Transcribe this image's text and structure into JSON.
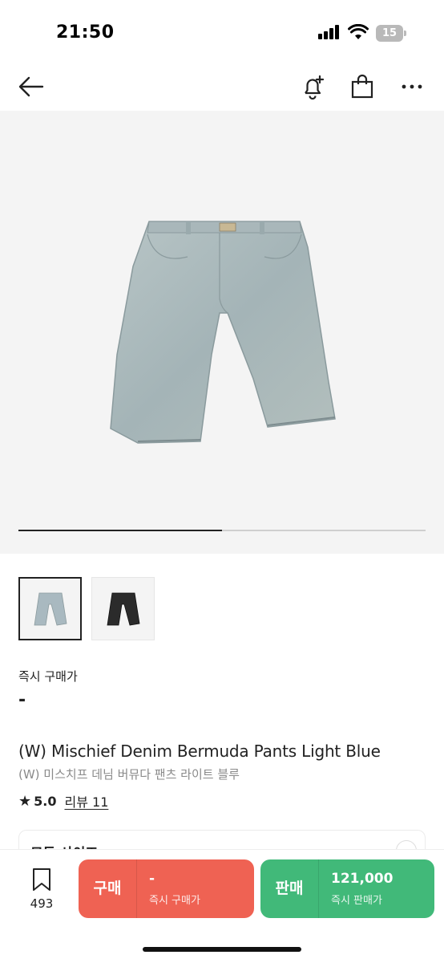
{
  "status_bar": {
    "time": "21:50",
    "battery_level": "15",
    "icons": [
      "cellular-signal-icon",
      "wifi-icon",
      "battery-icon"
    ]
  },
  "top_nav": {
    "icons": [
      "back-arrow-icon",
      "bell-plus-icon",
      "shopping-bag-icon",
      "more-icon"
    ]
  },
  "gallery": {
    "progress_fraction": 0.5,
    "thumbnails": [
      {
        "name": "light-blue-shorts",
        "color": "#a9b9c0",
        "selected": true
      },
      {
        "name": "black-shorts",
        "color": "#2b2b2b",
        "selected": false
      }
    ]
  },
  "price": {
    "label": "즉시 구매가",
    "value": "-"
  },
  "product": {
    "title_en": "(W) Mischief Denim Bermuda Pants Light Blue",
    "title_ko": "(W) 미스치프 데님 버뮤다 팬츠 라이트 블루",
    "rating": "5.0",
    "review_label": "리뷰 11"
  },
  "size_selector": {
    "label": "모든 사이즈"
  },
  "bottom_bar": {
    "bookmark_count": "493",
    "buy": {
      "label": "구매",
      "price": "-",
      "sub": "즉시 구매가",
      "color": "#ef6253"
    },
    "sell": {
      "label": "판매",
      "price": "121,000",
      "sub": "즉시 판매가",
      "color": "#41b979"
    }
  }
}
